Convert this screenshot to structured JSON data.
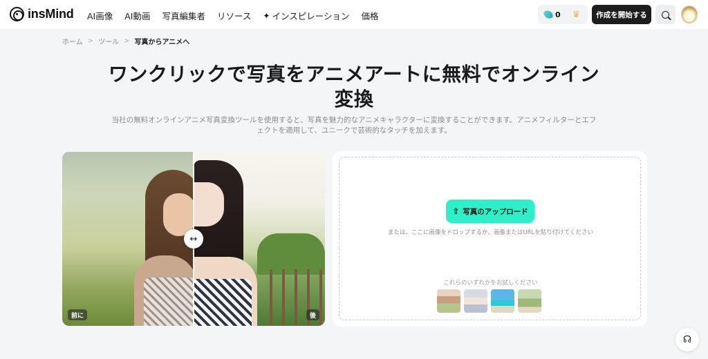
{
  "header": {
    "logo_text": "insMind",
    "nav": [
      {
        "label": "AI画像"
      },
      {
        "label": "AI動画"
      },
      {
        "label": "写真編集者"
      },
      {
        "label": "リソース"
      },
      {
        "label": "インスピレーション",
        "icon": "sparkle-icon"
      },
      {
        "label": "価格"
      }
    ],
    "credits": "0",
    "create_label": "作成を開始する"
  },
  "breadcrumb": {
    "items": [
      "ホーム",
      "ツール",
      "写真からアニメへ"
    ],
    "separator": ">"
  },
  "hero": {
    "title": "ワンクリックで写真をアニメアートに無料でオンライン変換",
    "subtitle": "当社の無料オンラインアニメ写真変換ツールを使用すると、写真を魅力的なアニメキャラクターに変換することができます。アニメフィルターとエフェクトを適用して、ユニークで芸術的なタッチを加えます。"
  },
  "compare": {
    "before_label": "前に",
    "after_label": "後",
    "handle_glyph": "↔"
  },
  "upload": {
    "button_label": "写真のアップロード",
    "drop_hint": "または、ここに画像をドロップするか、画像またはURLを貼り付けてください",
    "try_label": "これらのいずれかをお試しください",
    "samples": [
      "sample-1",
      "sample-2",
      "sample-3",
      "sample-4"
    ]
  },
  "colors": {
    "accent": "#2ef0c8",
    "dark_button": "#1d1d1d",
    "page_bg": "#f4f5f6"
  }
}
